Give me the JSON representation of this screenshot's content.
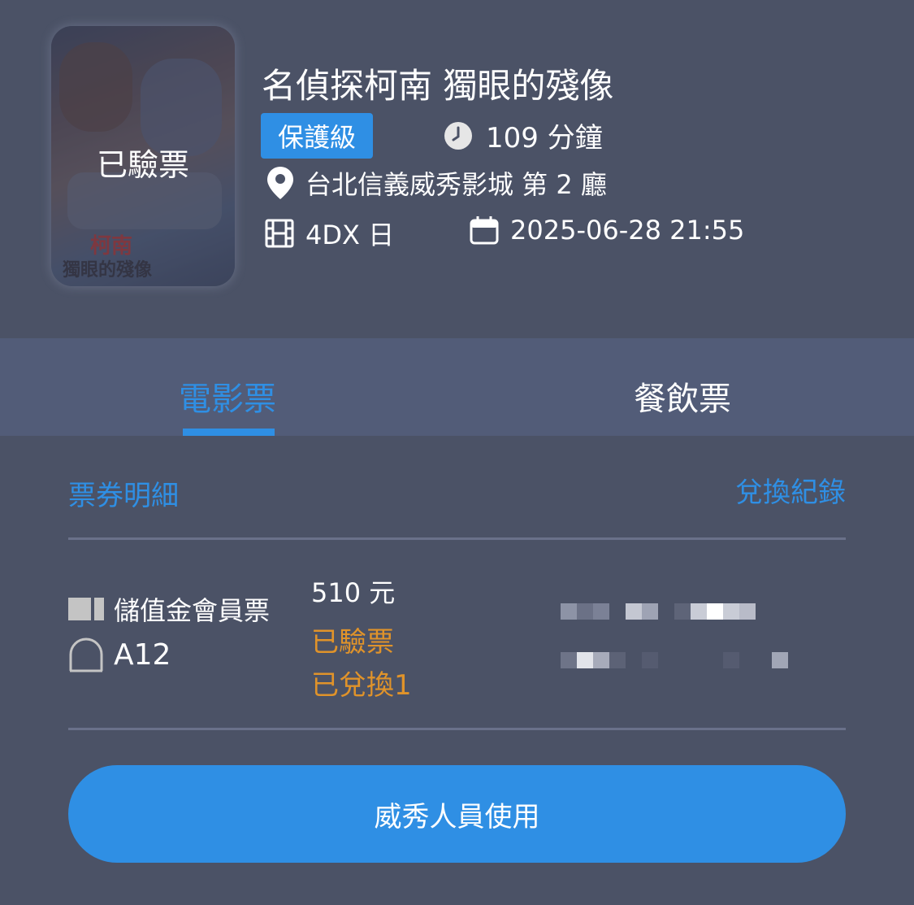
{
  "movie": {
    "poster_stamp": "已驗票",
    "poster_logo_text": "柯南",
    "poster_subtitle_text": "獨眼的殘像",
    "title": "名偵探柯南 獨眼的殘像",
    "rating": "保護級",
    "duration": "109 分鐘",
    "duration_icon": "clock-icon",
    "location": "台北信義威秀影城 第 2 廳",
    "location_icon": "location-pin-icon",
    "format": "4DX 日",
    "format_icon": "film-icon",
    "datetime": "2025-06-28 21:55",
    "datetime_icon": "calendar-icon"
  },
  "tabs": [
    {
      "label": "電影票",
      "active": true
    },
    {
      "label": "餐飲票",
      "active": false
    }
  ],
  "details": {
    "section_title": "票券明細",
    "history_link": "兌換紀錄"
  },
  "ticket": {
    "type": "儲值金會員票",
    "type_icon": "ticket-icon",
    "seat": "A12",
    "seat_icon": "seat-icon",
    "price": "510 元",
    "status_checked": "已驗票",
    "status_redeemed": "已兌換1"
  },
  "action": {
    "staff_button": "威秀人員使用"
  },
  "colors": {
    "background": "#4b5266",
    "tab_bar": "#525c78",
    "accent": "#2f8fe4",
    "status": "#e0932a"
  }
}
